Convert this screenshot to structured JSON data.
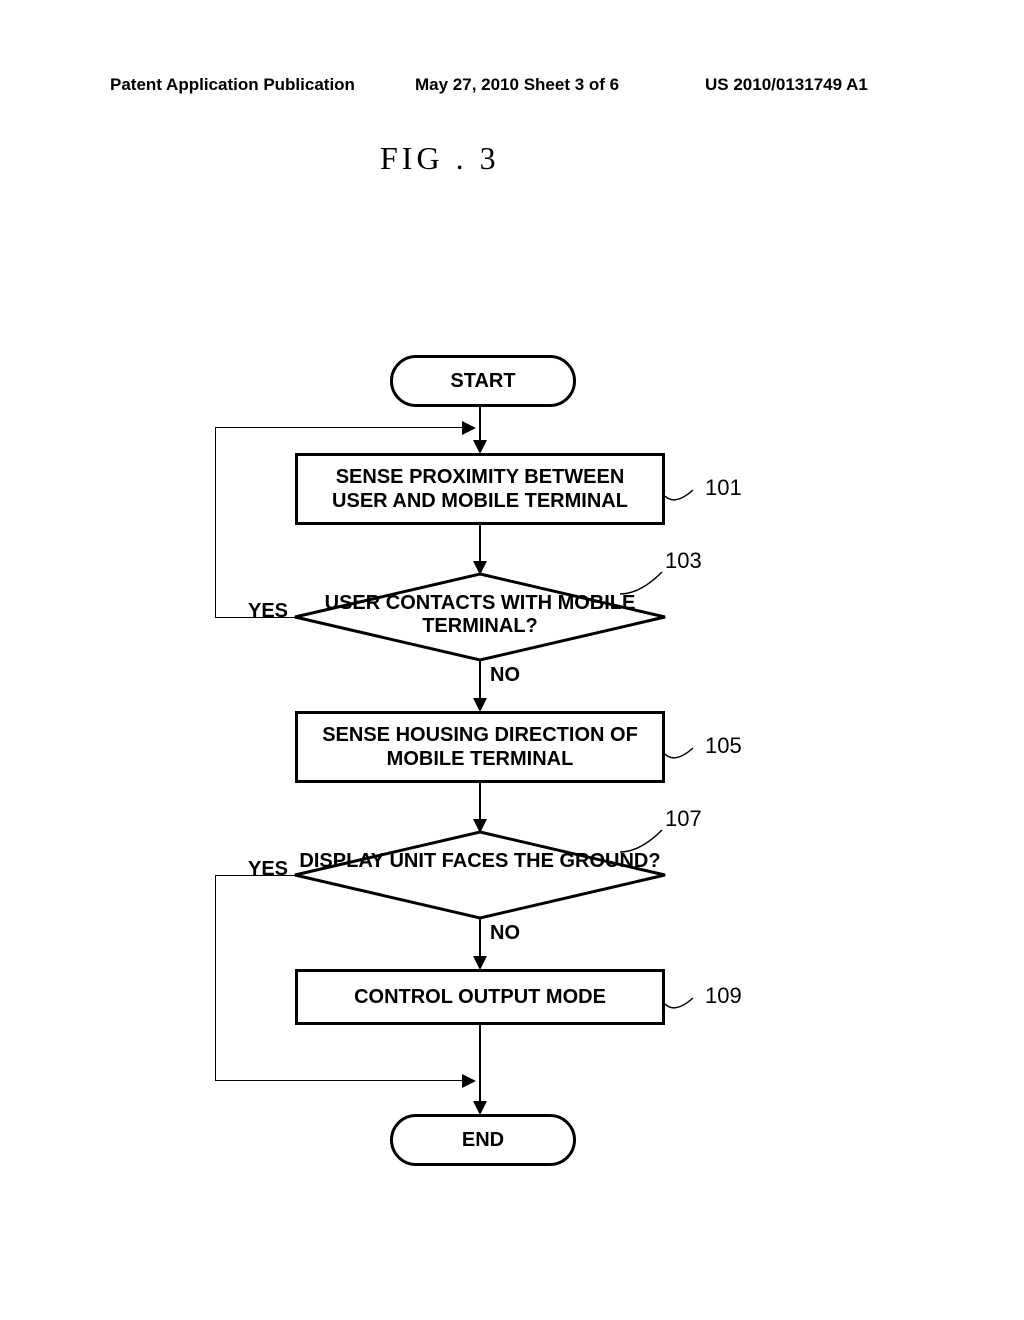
{
  "header": {
    "left": "Patent Application Publication",
    "center": "May 27, 2010  Sheet 3 of 6",
    "right": "US 2010/0131749 A1"
  },
  "figure": {
    "label": "FIG . 3"
  },
  "flow": {
    "start": "START",
    "end": "END",
    "step101": {
      "text": "SENSE PROXIMITY BETWEEN\nUSER AND MOBILE TERMINAL",
      "ref": "101"
    },
    "dec103": {
      "text": "USER CONTACTS\nWITH MOBILE TERMINAL?",
      "ref": "103",
      "yes": "YES",
      "no": "NO"
    },
    "step105": {
      "text": "SENSE HOUSING DIRECTION OF\nMOBILE TERMINAL",
      "ref": "105"
    },
    "dec107": {
      "text": "DISPLAY UNIT\nFACES THE GROUND?",
      "ref": "107",
      "yes": "YES",
      "no": "NO"
    },
    "step109": {
      "text": "CONTROL OUTPUT MODE",
      "ref": "109"
    }
  },
  "chart_data": {
    "type": "flowchart",
    "nodes": [
      {
        "id": "start",
        "shape": "terminal",
        "label": "START"
      },
      {
        "id": "n101",
        "shape": "process",
        "label": "SENSE PROXIMITY BETWEEN USER AND MOBILE TERMINAL",
        "ref": "101"
      },
      {
        "id": "n103",
        "shape": "decision",
        "label": "USER CONTACTS WITH MOBILE TERMINAL?",
        "ref": "103"
      },
      {
        "id": "n105",
        "shape": "process",
        "label": "SENSE HOUSING DIRECTION OF MOBILE TERMINAL",
        "ref": "105"
      },
      {
        "id": "n107",
        "shape": "decision",
        "label": "DISPLAY UNIT FACES THE GROUND?",
        "ref": "107"
      },
      {
        "id": "n109",
        "shape": "process",
        "label": "CONTROL OUTPUT MODE",
        "ref": "109"
      },
      {
        "id": "end",
        "shape": "terminal",
        "label": "END"
      }
    ],
    "edges": [
      {
        "from": "start",
        "to": "n101"
      },
      {
        "from": "n101",
        "to": "n103"
      },
      {
        "from": "n103",
        "to": "n101",
        "label": "YES"
      },
      {
        "from": "n103",
        "to": "n105",
        "label": "NO"
      },
      {
        "from": "n105",
        "to": "n107"
      },
      {
        "from": "n107",
        "to": "end",
        "label": "YES"
      },
      {
        "from": "n107",
        "to": "n109",
        "label": "NO"
      },
      {
        "from": "n109",
        "to": "end"
      }
    ]
  }
}
